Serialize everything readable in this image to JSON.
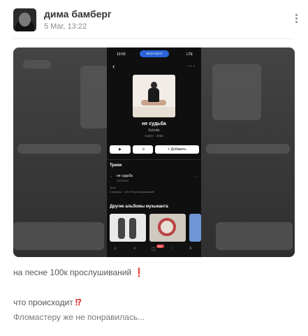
{
  "post": {
    "author": "дима бамберг",
    "date": "5 Mar, 13:22",
    "avatar": "avatar",
    "more_icon": "more-vertical-icon"
  },
  "media": {
    "phone": {
      "status_time": "13:03",
      "status_pill": "ВКОНТАКТЕ",
      "status_icons": "LTE",
      "track_title": "не судьба",
      "artist": "Schokk",
      "meta": "Сингл · 2025",
      "buttons": {
        "play": "▶",
        "shuffle": "⤨",
        "add": "+ Добавить"
      },
      "tracks_header": "Треки",
      "track_item": {
        "title": "не судьба",
        "artist": "SCHOKK"
      },
      "track_stats_line1": "Трек",
      "track_stats_line2": "5 минуты · 100,7К прослушиваний",
      "other_albums_header": "Другие альбомы музыканта",
      "tab_badge": "99+"
    }
  },
  "caption": {
    "line1": "на песне 100к прослушиваний",
    "line1_emoji": "❗",
    "line2": "что происходит",
    "line2_emoji": "⁉",
    "line3": "Фломастеру же не понравилась..."
  },
  "colors": {
    "accent_blue": "#2a64d8",
    "emoji_red": "#e02020"
  }
}
